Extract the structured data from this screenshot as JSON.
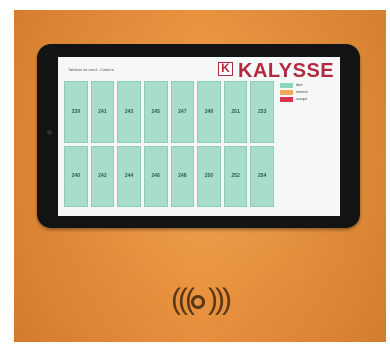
{
  "screen": {
    "title": "Tableau de bord - Casiers"
  },
  "brand": {
    "logo_mark": "K",
    "name": "KALYSSE",
    "color": "#b22a3f"
  },
  "lockers": {
    "top_row": [
      "239",
      "241",
      "243",
      "245",
      "247",
      "249",
      "251",
      "253"
    ],
    "bottom_row": [
      "240",
      "242",
      "244",
      "246",
      "248",
      "250",
      "252",
      "254"
    ],
    "cell_color": "#a8dccb"
  },
  "legend": [
    {
      "label": "libre",
      "color": "#8fd6c0"
    },
    {
      "label": "réservé",
      "color": "#f0a860"
    },
    {
      "label": "occupé",
      "color": "#d8344f"
    }
  ],
  "nfc": {
    "icon": "contactless-icon"
  }
}
